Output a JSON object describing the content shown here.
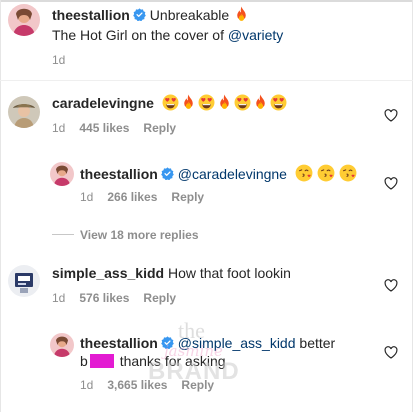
{
  "caption": {
    "username": "theestallion",
    "text_line1": "Unbreakable",
    "text_line2": "The Hot Girl on the cover of",
    "mention": "@variety",
    "time": "1d"
  },
  "comments": [
    {
      "username": "caradelevingne",
      "time": "1d",
      "likes": "445 likes",
      "reply_label": "Reply",
      "emojis": [
        "heart-eyes",
        "fire",
        "heart-eyes",
        "fire",
        "heart-eyes",
        "fire",
        "heart-eyes"
      ],
      "reply": {
        "username": "theestallion",
        "mention": "@caradelevingne",
        "emojis": [
          "kissing-heart",
          "kissing-heart",
          "kissing-heart"
        ],
        "time": "1d",
        "likes": "266 likes",
        "reply_label": "Reply"
      },
      "view_more": "View 18 more replies"
    },
    {
      "username": "simple_ass_kidd",
      "text": "How that foot lookin",
      "time": "1d",
      "likes": "576 likes",
      "reply_label": "Reply",
      "reply": {
        "username": "theestallion",
        "mention": "@simple_ass_kidd",
        "text_line1_suffix": "better",
        "text_line2_prefix": "b",
        "text_line2_suffix": "thanks for asking",
        "time": "1d",
        "likes": "3,665 likes",
        "reply_label": "Reply"
      }
    }
  ],
  "watermark": {
    "line1": "the",
    "line2": "jasmine",
    "line3": "BRAND"
  },
  "icons": {
    "verified": "verified-badge-icon",
    "like": "heart-outline-icon",
    "fire": "fire-emoji",
    "heart_eyes": "heart-eyes-emoji",
    "kissing_heart": "kissing-heart-emoji"
  },
  "colors": {
    "text": "#262626",
    "meta": "#8e8e8e",
    "mention": "#00376b",
    "verified": "#3897f0",
    "censor": "#e31bd2"
  }
}
